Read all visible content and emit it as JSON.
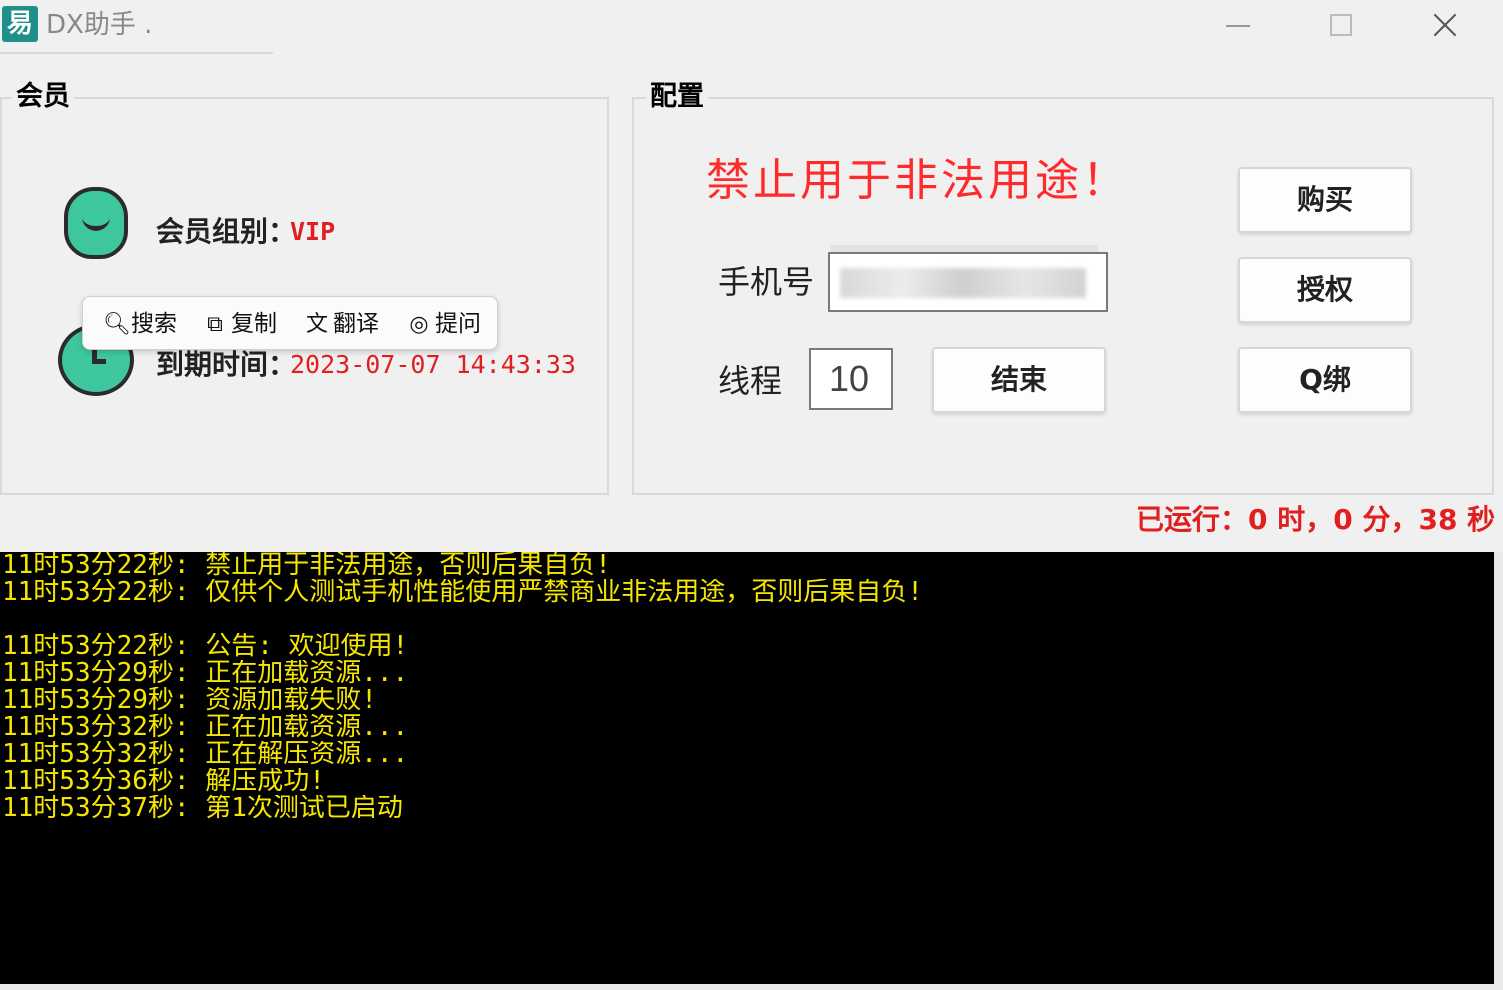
{
  "window": {
    "title": "DX助手 .",
    "icon_glyph": "易"
  },
  "member_section": {
    "legend": "会员",
    "group_label": "会员组别：",
    "group_value": "VIP",
    "expire_label": "到期时间：",
    "expire_value": "2023-07-07 14:43:33"
  },
  "context_popup": {
    "items": [
      {
        "icon": "search-icon",
        "glyph": "🔍︎",
        "label": "搜索"
      },
      {
        "icon": "copy-icon",
        "glyph": "⧉",
        "label": "复制"
      },
      {
        "icon": "translate-icon",
        "glyph": "文",
        "label": "翻译"
      },
      {
        "icon": "ask-icon",
        "glyph": "◎",
        "label": "提问"
      }
    ]
  },
  "config_section": {
    "legend": "配置",
    "warning": "禁止用于非法用途！",
    "phone_label": "手机号",
    "thread_label": "线程",
    "thread_value": "10",
    "end_button": "结束",
    "buy_button": "购买",
    "auth_button": "授权",
    "qbind_button": "Q绑"
  },
  "runtime": "已运行：0 时，0 分，38 秒",
  "console": {
    "lines": [
      "11时53分22秒: 禁止用于非法用途，否则后果自负!",
      "11时53分22秒: 仅供个人测试手机性能使用严禁商业非法用途，否则后果自负!",
      "",
      "11时53分22秒: 公告: 欢迎使用!",
      "11时53分29秒: 正在加载资源...",
      "11时53分29秒: 资源加载失败!",
      "11时53分32秒: 正在加载资源...",
      "11时53分32秒: 正在解压资源...",
      "11时53分36秒: 解压成功!",
      "11时53分37秒: 第1次测试已启动"
    ],
    "text_color": "#f5e600",
    "background": "#000000"
  },
  "colors": {
    "accent_red": "#e02020",
    "warning_red": "#ff2a2a",
    "avatar_green": "#3ec79e"
  }
}
